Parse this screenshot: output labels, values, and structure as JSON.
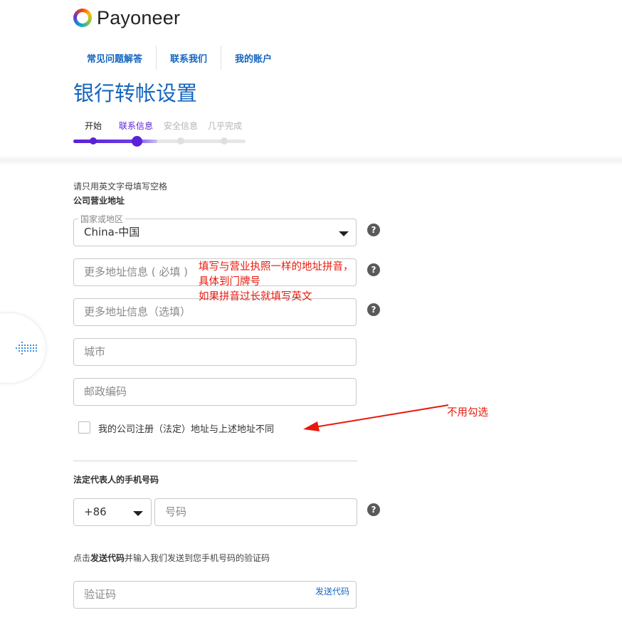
{
  "brand": {
    "logo_text": "Payoneer"
  },
  "nav": {
    "items": [
      "常见问题解答",
      "联系我们",
      "我的账户"
    ]
  },
  "page": {
    "title": "银行转帐设置"
  },
  "stepper": {
    "steps": [
      "开始",
      "联系信息",
      "安全信息",
      "几乎完成"
    ],
    "current_step": 2,
    "colors": {
      "done": "#222222",
      "active": "#5b21d6",
      "inactive": "#b3b3b3"
    }
  },
  "form": {
    "note": "请只用英文字母填写空格",
    "address_section_label": "公司营业地址",
    "country": {
      "label": "国家或地区",
      "value": "China-中国"
    },
    "address_required": {
      "placeholder": "更多地址信息 ( 必填 )"
    },
    "address_optional": {
      "placeholder": "更多地址信息（选填）"
    },
    "city": {
      "placeholder": "城市"
    },
    "postal_code": {
      "placeholder": "邮政编码"
    },
    "different_address_checkbox": {
      "label": "我的公司注册（法定）地址与上述地址不同",
      "checked": false
    },
    "phone_section_label": "法定代表人的手机号码",
    "phone_code": {
      "value": "+86"
    },
    "phone_number": {
      "placeholder": "号码"
    },
    "code_hint": {
      "prefix": "点击",
      "bold": "发送代码",
      "suffix": "并输入我们发送到您手机号码的验证码"
    },
    "verification_code": {
      "placeholder": "验证码",
      "send_label": "发送代码"
    },
    "help_icon_text": "?"
  },
  "annotations": {
    "address_note_line1": "填写与营业执照一样的地址拼音，",
    "address_note_line2": "具体到门牌号",
    "address_note_line3": "如果拼音过长就填写英文",
    "checkbox_note": "不用勾选",
    "color": "#e8180c"
  },
  "colors": {
    "accent": "#1565c0",
    "progress": "#5b21d6"
  }
}
